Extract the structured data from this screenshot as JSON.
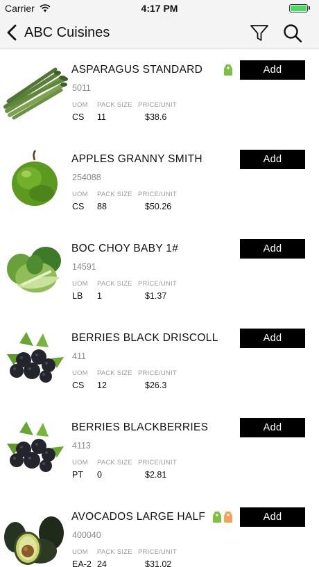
{
  "status_bar": {
    "carrier": "Carrier",
    "time": "4:17 PM",
    "battery_level": 1.0,
    "battery_color": "#4cd964"
  },
  "nav": {
    "title": "ABC Cuisines",
    "back_icon": "chevron-left-icon",
    "filter_icon": "filter-icon",
    "search_icon": "search-icon"
  },
  "columns": {
    "uom": "UOM",
    "pack": "PACK SIZE",
    "price": "PRICE/UNIT"
  },
  "add_label": "Add",
  "tag_colors": {
    "green": "#7cc242",
    "orange": "#f2a35a"
  },
  "products": [
    {
      "name": "ASPARAGUS STANDARD",
      "code": "5011",
      "uom": "CS",
      "pack": "11",
      "price": "$38.6",
      "image": "asparagus",
      "tags": [
        "green"
      ]
    },
    {
      "name": "APPLES GRANNY SMITH",
      "code": "254088",
      "uom": "CS",
      "pack": "88",
      "price": "$50.26",
      "image": "apple",
      "tags": []
    },
    {
      "name": "BOC CHOY BABY 1#",
      "code": "14591",
      "uom": "LB",
      "pack": "1",
      "price": "$1.37",
      "image": "bokchoy",
      "tags": []
    },
    {
      "name": "BERRIES BLACK DRISCOLL",
      "code": "411",
      "uom": "CS",
      "pack": "12",
      "price": "$26.3",
      "image": "blackberries",
      "tags": []
    },
    {
      "name": "BERRIES BLACKBERRIES",
      "code": "4113",
      "uom": "PT",
      "pack": "0",
      "price": "$2.81",
      "image": "blackberries",
      "tags": []
    },
    {
      "name": "AVOCADOS LARGE HALF",
      "code": "400040",
      "uom": "EA-2",
      "pack": "24",
      "price": "$31.02",
      "image": "avocado",
      "tags": [
        "green",
        "orange"
      ]
    }
  ]
}
